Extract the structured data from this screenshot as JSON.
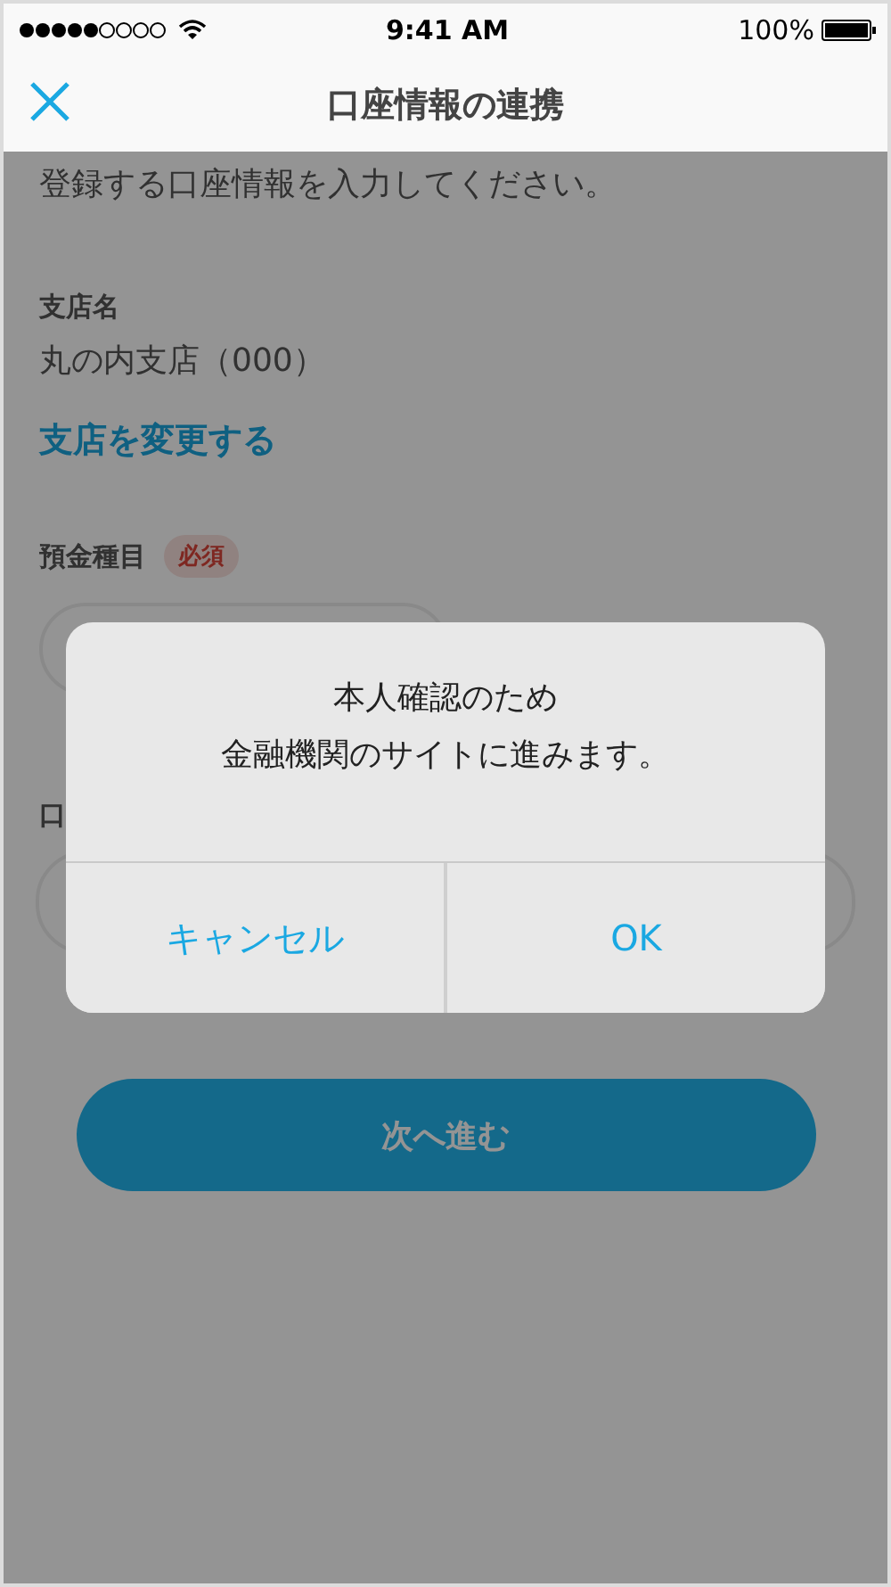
{
  "status_bar": {
    "time": "9:41 AM",
    "battery": "100%"
  },
  "nav": {
    "title": "口座情報の連携"
  },
  "form": {
    "intro": "登録する口座情報を入力してください。",
    "branch_label": "支店名",
    "branch_value": "丸の内支店（000）",
    "change_link": "支店を変更する",
    "deposit_type": {
      "label": "預金種目",
      "badge": "必須"
    },
    "account_label": "口"
  },
  "next_button": "次へ進む",
  "dialog": {
    "message_lines": [
      "本人確認のため",
      "金融機関のサイトに進みます。"
    ],
    "buttons": [
      "キャンセル",
      "OK"
    ]
  }
}
